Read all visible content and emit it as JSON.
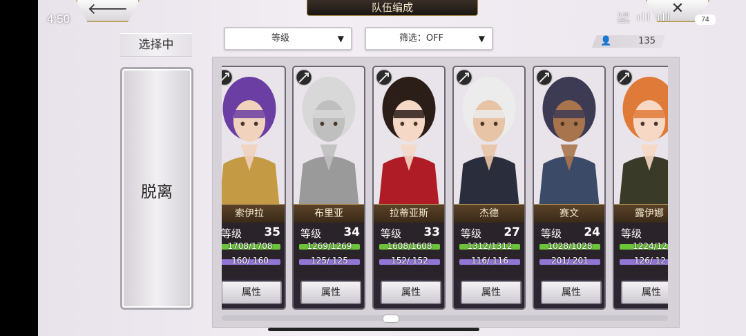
{
  "status": {
    "time": "4:50",
    "net_speed": "0.10",
    "net_unit": "KB/s",
    "signals": "ıll ıll",
    "battery": "74"
  },
  "header": {
    "title": "队伍编成",
    "back_icon": "arrow-left-icon",
    "close_icon": "close-icon"
  },
  "toolbar": {
    "sort_label": "等级",
    "filter_label": "筛选：OFF",
    "count": "135"
  },
  "left": {
    "selecting_label": "选择中",
    "leave_label": "脱离"
  },
  "units": [
    {
      "name": "索伊拉",
      "level_label": "等级",
      "level": "35",
      "hp": "1708/1708",
      "mp": "160/ 160",
      "attr_label": "属性",
      "hair": "#6b3ea3",
      "skin": "#f0d2bd",
      "outfit": "#c59a45"
    },
    {
      "name": "布里亚",
      "level_label": "等级",
      "level": "34",
      "hp": "1269/1269",
      "mp": "125/ 125",
      "attr_label": "属性",
      "hair": "#d8d8d8",
      "skin": "#bfbfbf",
      "outfit": "#9a9a9a"
    },
    {
      "name": "拉蒂亚斯",
      "level_label": "等级",
      "level": "33",
      "hp": "1608/1608",
      "mp": "152/ 152",
      "attr_label": "属性",
      "hair": "#2b1d18",
      "skin": "#f5d8c6",
      "outfit": "#b01c25"
    },
    {
      "name": "杰德",
      "level_label": "等级",
      "level": "27",
      "hp": "1312/1312",
      "mp": "116/ 116",
      "attr_label": "属性",
      "hair": "#ececec",
      "skin": "#e8c4a6",
      "outfit": "#2a2d3c"
    },
    {
      "name": "赛文",
      "level_label": "等级",
      "level": "24",
      "hp": "1028/1028",
      "mp": "201/ 201",
      "attr_label": "属性",
      "hair": "#3d3b54",
      "skin": "#a8744d",
      "outfit": "#3b4a66"
    },
    {
      "name": "露伊娜",
      "level_label": "等级",
      "level": "2",
      "hp": "1224/12",
      "mp": "126/ 12",
      "attr_label": "属性",
      "hair": "#e07a38",
      "skin": "#f6d8c5",
      "outfit": "#3a3a28"
    }
  ]
}
